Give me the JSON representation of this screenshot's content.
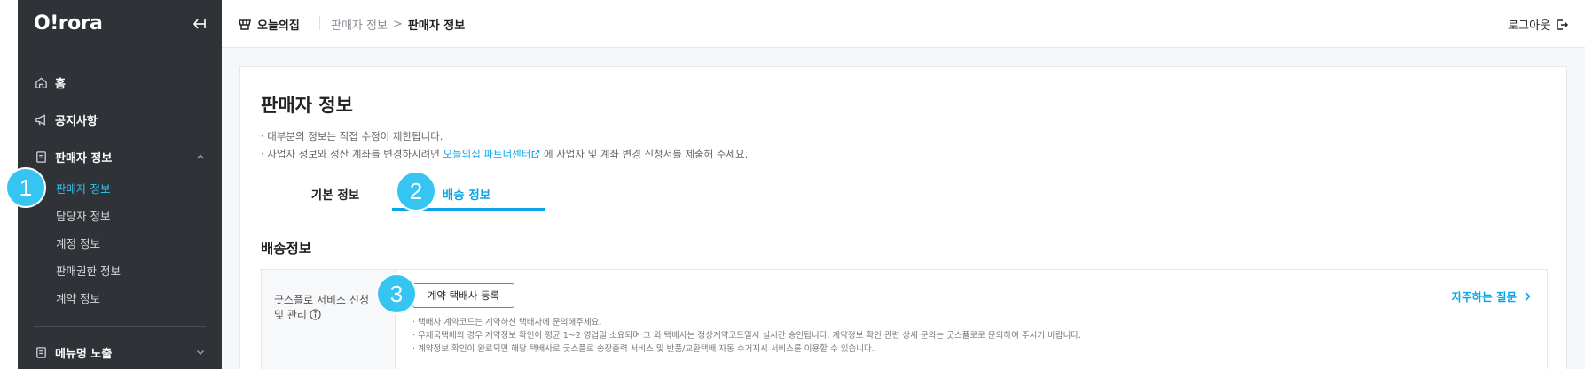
{
  "sidebar": {
    "logo": "O!rora",
    "nav": {
      "home": "홈",
      "notice": "공지사항",
      "seller_info": "판매자 정보",
      "menu_display": "메뉴명 노출"
    },
    "sub_items": [
      "판매자 정보",
      "담당자 정보",
      "계정 정보",
      "판매권한 정보",
      "계약 정보"
    ]
  },
  "header": {
    "brand": "오늘의집",
    "breadcrumb_parent": "판매자 정보",
    "breadcrumb_sep": ">",
    "breadcrumb_current": "판매자 정보",
    "logout": "로그아웃"
  },
  "badges": [
    "1",
    "2",
    "3"
  ],
  "main": {
    "title": "판매자 정보",
    "note1": "· 대부분의 정보는 직접 수정이 제한됩니다.",
    "note2_pre": "· 사업자 정보와 정산 계좌를 변경하시려면 ",
    "note2_link": "오늘의집 파트너센터",
    "note2_post": " 에 사업자 및 계좌 변경 신청서를 제출해 주세요.",
    "tabs": [
      "기본 정보",
      "배송 정보"
    ],
    "section_title": "배송정보",
    "form": {
      "label_line1": "굿스플로 서비스 신청",
      "label_line2": "및 관리",
      "register_button": "계약 택배사 등록",
      "faq": "자주하는 질문",
      "help": [
        "· 택배사 계약코드는 계약하신 택배사에 문의해주세요.",
        "· 우체국택배의 경우 계약정보 확인이 평균 1~2 영업일 소요되며 그 외 택배사는 정상계약코드일시 실시간 승인됩니다. 계약정보 확인 관련 상세 문의는 굿스플로로 문의하여 주시기 바랍니다.",
        "· 계약정보 확인이 완료되면 해당 택배사로 굿스플로 송장출력 서비스 및 반품/교환택배 자동 수거지시 서비스를 이용할 수 있습니다."
      ]
    }
  },
  "colors": {
    "accent": "#35c5f0",
    "link": "#0aa5e8",
    "sidebar_bg": "#2f3337"
  }
}
